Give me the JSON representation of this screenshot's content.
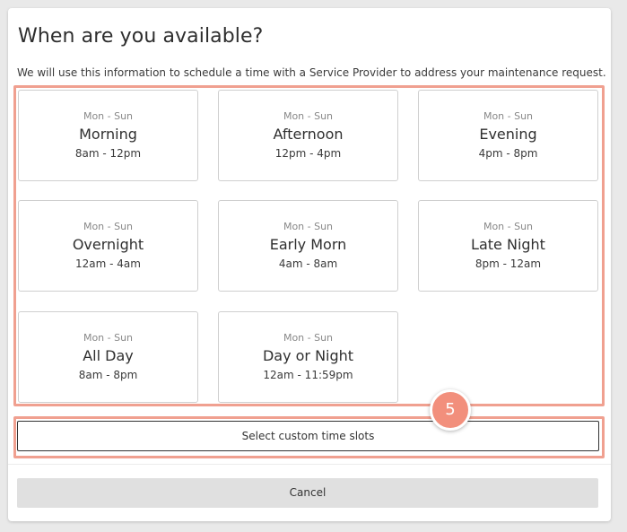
{
  "dialog": {
    "title": "When are you available?",
    "subtitle": "We will use this information to schedule a time with a Service Provider to address your maintenance request."
  },
  "slots": [
    {
      "days": "Mon - Sun",
      "name": "Morning",
      "hours": "8am - 12pm"
    },
    {
      "days": "Mon - Sun",
      "name": "Afternoon",
      "hours": "12pm - 4pm"
    },
    {
      "days": "Mon - Sun",
      "name": "Evening",
      "hours": "4pm - 8pm"
    },
    {
      "days": "Mon - Sun",
      "name": "Overnight",
      "hours": "12am - 4am"
    },
    {
      "days": "Mon - Sun",
      "name": "Early Morn",
      "hours": "4am - 8am"
    },
    {
      "days": "Mon - Sun",
      "name": "Late Night",
      "hours": "8pm - 12am"
    },
    {
      "days": "Mon - Sun",
      "name": "All Day",
      "hours": "8am - 8pm"
    },
    {
      "days": "Mon - Sun",
      "name": "Day or Night",
      "hours": "12am - 11:59pm"
    }
  ],
  "custom_slots_label": "Select custom time slots",
  "step_badge": "5",
  "cancel_label": "Cancel",
  "colors": {
    "highlight": "#f0a090",
    "badge": "#f28f7c",
    "cancel_bg": "#e0e0e0"
  }
}
